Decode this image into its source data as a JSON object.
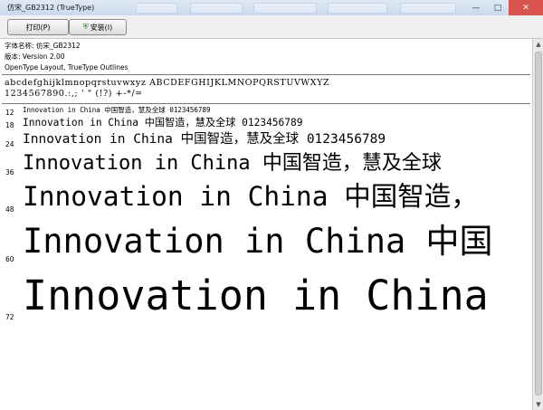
{
  "window": {
    "title": "仿宋_GB2312 (TrueType)"
  },
  "toolbar": {
    "print_label": "打印(P)",
    "install_label": "安装(I)",
    "install_icon": "shield-icon"
  },
  "info": {
    "font_name": "字体名称: 仿宋_GB2312",
    "version": "版本: Version 2.00",
    "features": "OpenType Layout, TrueType Outlines"
  },
  "charset": {
    "line1": "abcdefghijklmnopqrstuvwxyz ABCDEFGHIJKLMNOPQRSTUVWXYZ",
    "line2": "1234567890.:,; ' \" (!?) +-*/="
  },
  "samples": [
    {
      "size": "12",
      "text": "Innovation in China 中国智造，慧及全球 0123456789"
    },
    {
      "size": "18",
      "text": "Innovation in China 中国智造，慧及全球 0123456789"
    },
    {
      "size": "24",
      "text": "Innovation in China 中国智造，慧及全球 0123456789"
    },
    {
      "size": "36",
      "text": "Innovation in China 中国智造，慧及全球"
    },
    {
      "size": "48",
      "text": "Innovation in China 中国智造，"
    },
    {
      "size": "60",
      "text": "Innovation in China 中国"
    },
    {
      "size": "72",
      "text": "Innovation in China"
    }
  ]
}
